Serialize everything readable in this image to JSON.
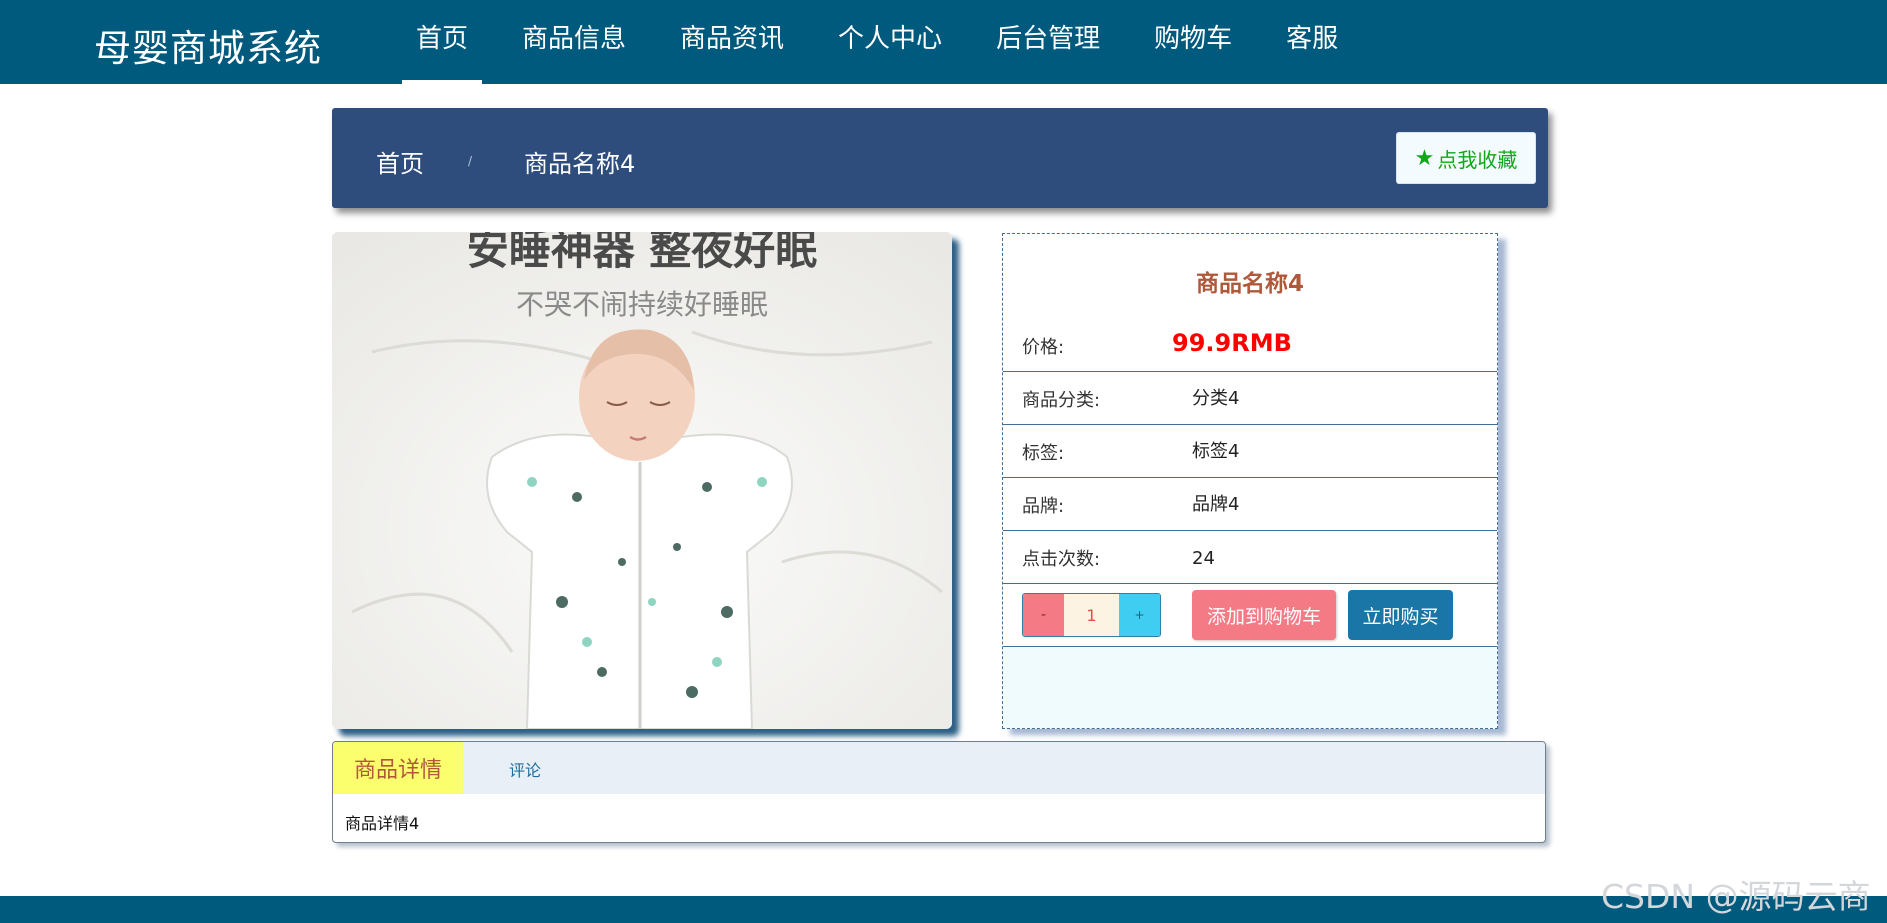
{
  "brand": "母婴商城系统",
  "nav": {
    "items": [
      {
        "label": "首页",
        "active": true
      },
      {
        "label": "商品信息",
        "active": false
      },
      {
        "label": "商品资讯",
        "active": false
      },
      {
        "label": "个人中心",
        "active": false
      },
      {
        "label": "后台管理",
        "active": false
      },
      {
        "label": "购物车",
        "active": false
      },
      {
        "label": "客服",
        "active": false
      }
    ]
  },
  "breadcrumb": {
    "home": "首页",
    "separator": "/",
    "current": "商品名称4"
  },
  "favorite_button": {
    "icon": "star-icon",
    "label": "点我收藏"
  },
  "product_image": {
    "headline": "安睡神器 整夜好眠",
    "subline": "不哭不闹持续好睡眠"
  },
  "product": {
    "title": "商品名称4",
    "fields": [
      {
        "label": "价格:",
        "value": "99.9RMB"
      },
      {
        "label": "商品分类:",
        "value": "分类4"
      },
      {
        "label": "标签:",
        "value": "标签4"
      },
      {
        "label": "品牌:",
        "value": "品牌4"
      },
      {
        "label": "点击次数:",
        "value": "24"
      }
    ]
  },
  "quantity": {
    "minus": "-",
    "value": "1",
    "plus": "+"
  },
  "actions": {
    "add_to_cart": "添加到购物车",
    "buy_now": "立即购买"
  },
  "tabs": {
    "detail_label": "商品详情",
    "review_label": "评论",
    "detail_content": "商品详情4"
  },
  "watermark": "CSDN @源码云商",
  "colors": {
    "nav_bg": "#005a7d",
    "breadcrumb_bg": "#2e4d7d",
    "price": "#ff0000",
    "title": "#b0583a",
    "cart_button": "#f47a86",
    "buy_button": "#1b76a8",
    "favorite_text": "#12a61a",
    "active_tab": "#fbff6e"
  }
}
